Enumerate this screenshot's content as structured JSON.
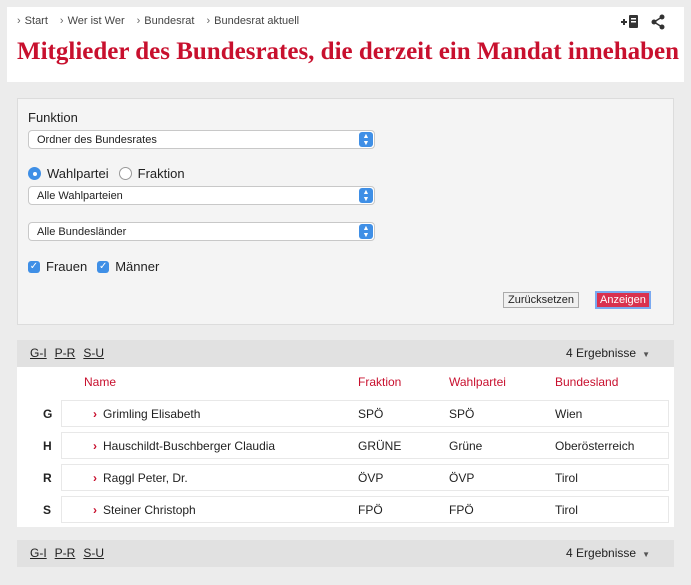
{
  "breadcrumb": [
    "Start",
    "Wer ist Wer",
    "Bundesrat",
    "Bundesrat aktuell"
  ],
  "page_title": "Mitglieder des Bundesrates, die derzeit ein Mandat innehaben",
  "filter": {
    "funktion_label": "Funktion",
    "funktion_value": "Ordner des Bundesrates",
    "radio_wahlpartei": "Wahlpartei",
    "radio_fraktion": "Fraktion",
    "wahlpartei_value": "Alle Wahlparteien",
    "bundesland_value": "Alle Bundesländer",
    "check_frauen": "Frauen",
    "check_maenner": "Männer",
    "reset_label": "Zurücksetzen",
    "show_label": "Anzeigen"
  },
  "letter_groups": [
    "G-I",
    "P-R",
    "S-U"
  ],
  "result_count": "4 Ergebnisse",
  "table": {
    "headers": [
      "Name",
      "Fraktion",
      "Wahlpartei",
      "Bundesland"
    ],
    "rows": [
      {
        "initial": "G",
        "name": "Grimling Elisabeth",
        "fraktion": "SPÖ",
        "wahlpartei": "SPÖ",
        "bundesland": "Wien"
      },
      {
        "initial": "H",
        "name": "Hauschildt-Buschberger Claudia",
        "fraktion": "GRÜNE",
        "wahlpartei": "Grüne",
        "bundesland": "Oberösterreich"
      },
      {
        "initial": "R",
        "name": "Raggl Peter, Dr.",
        "fraktion": "ÖVP",
        "wahlpartei": "ÖVP",
        "bundesland": "Tirol"
      },
      {
        "initial": "S",
        "name": "Steiner Christoph",
        "fraktion": "FPÖ",
        "wahlpartei": "FPÖ",
        "bundesland": "Tirol"
      }
    ]
  },
  "colors": {
    "accent": "#c8102e",
    "control": "#3f8fe6"
  }
}
